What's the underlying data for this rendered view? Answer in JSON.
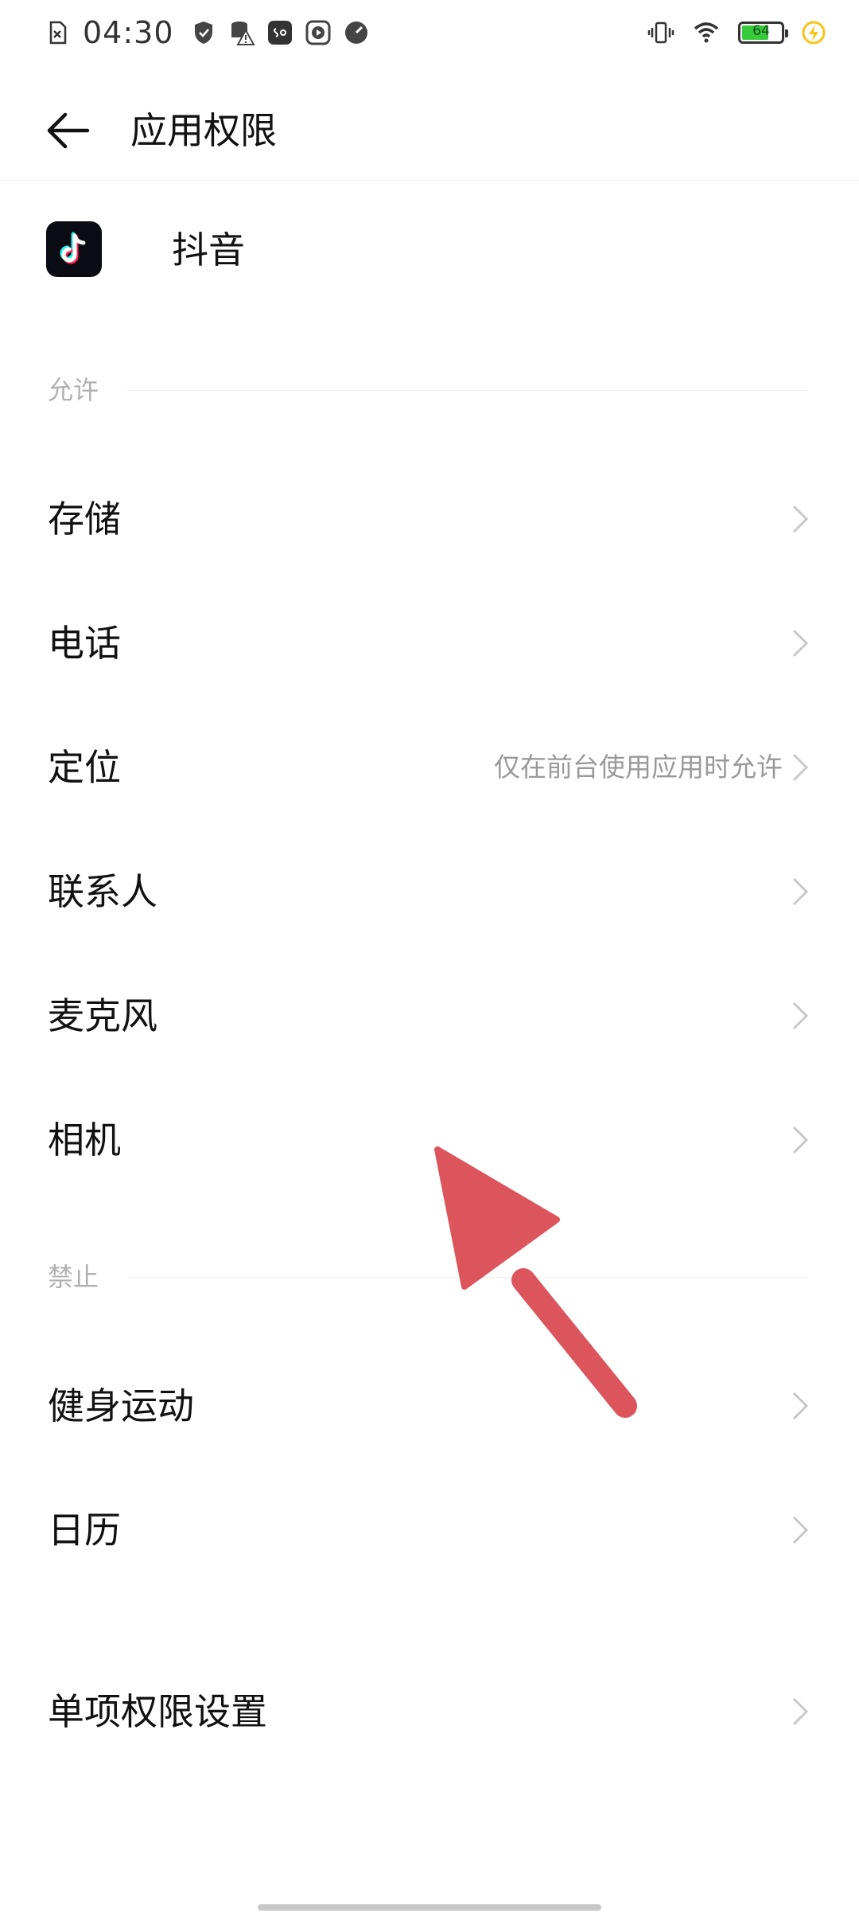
{
  "status_bar": {
    "time": "04:30",
    "left_icons": [
      "sim-missing-icon",
      "shield-icon",
      "data-warning-icon",
      "soul-app-icon",
      "video-play-icon",
      "speedometer-icon"
    ],
    "right_icons": [
      "vibrate-icon",
      "wifi-icon",
      "battery-icon",
      "charging-bolt-icon"
    ],
    "battery_level": "64"
  },
  "header": {
    "title": "应用权限"
  },
  "app": {
    "name": "抖音"
  },
  "sections": {
    "allowed_label": "允许",
    "denied_label": "禁止"
  },
  "allowed_items": [
    {
      "label": "存储",
      "value": ""
    },
    {
      "label": "电话",
      "value": ""
    },
    {
      "label": "定位",
      "value": "仅在前台使用应用时允许"
    },
    {
      "label": "联系人",
      "value": ""
    },
    {
      "label": "麦克风",
      "value": ""
    },
    {
      "label": "相机",
      "value": ""
    }
  ],
  "denied_items": [
    {
      "label": "健身运动",
      "value": ""
    },
    {
      "label": "日历",
      "value": ""
    }
  ],
  "extra": {
    "individual_settings": "单项权限设置"
  },
  "colors": {
    "accent_arrow": "#dc545c",
    "battery_fill": "#36c93a",
    "charge_bolt": "#f5c518"
  }
}
